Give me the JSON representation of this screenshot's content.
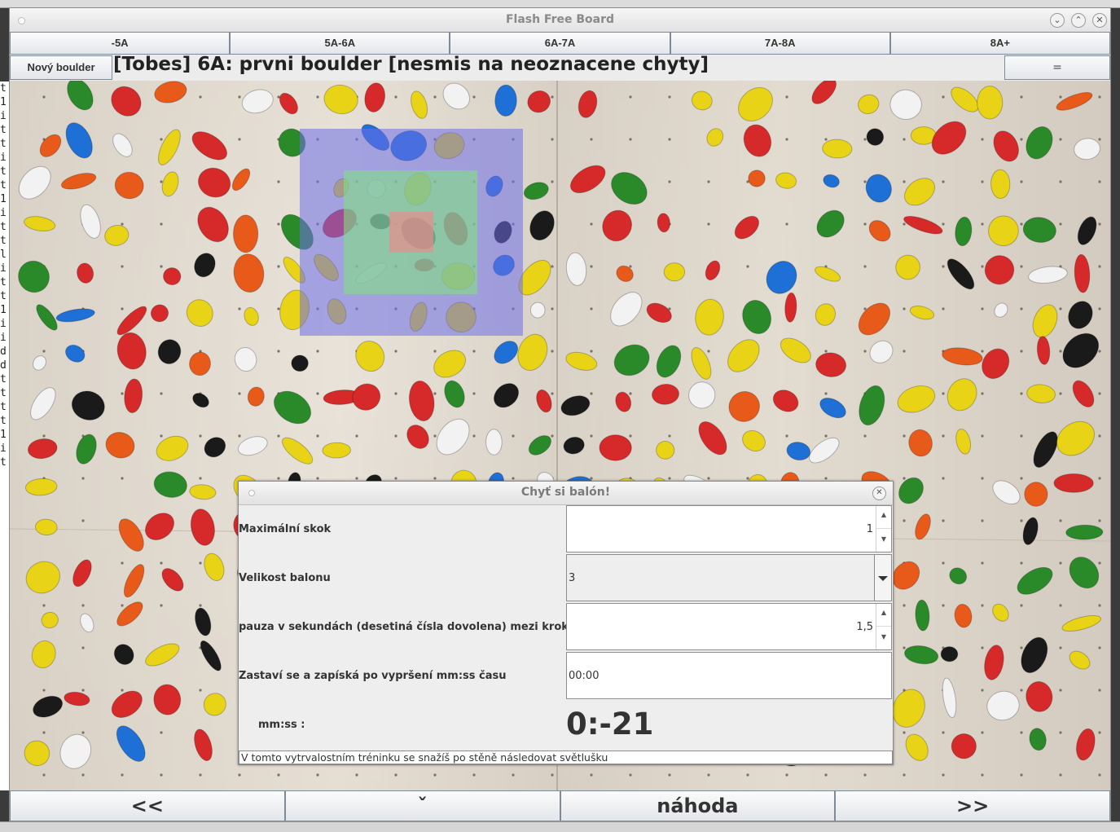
{
  "window": {
    "title": "Flash Free Board"
  },
  "grades": [
    "-5A",
    "5A-6A",
    "6A-7A",
    "7A-8A",
    "8A+"
  ],
  "boulder": {
    "new_label": "Nový boulder",
    "title": "[Tobes] 6A: prvni boulder [nesmis na neoznacene chyty]",
    "menu_label": "="
  },
  "nav": {
    "prev": "<<",
    "middle": "ˇ",
    "random": "náhoda",
    "next": ">>"
  },
  "dialog": {
    "title": "Chyť si balón!",
    "max_jump_label": "Maximální skok",
    "max_jump_value": "1",
    "ball_size_label": "Velikost balonu",
    "ball_size_value": "3",
    "pause_label": "pauza v sekundách (desetiná čísla dovolena) mezi kroky",
    "pause_value": "1,5",
    "stop_label": "Zastaví se a zapíská po  vypršení mm:ss času",
    "stop_value": "00:00",
    "mmss_label": "mm:ss :",
    "timer": "0:-21",
    "description": "V tomto vytrvalostním tréninku se snažíš po stěně následovat světlušku"
  },
  "terminal_chars": "t1ittitt1ittlitt1iiddtttt1it",
  "colors": {
    "focus_outer": "#6d6de8",
    "focus_middle": "#82e082",
    "focus_inner": "#e88c8c"
  }
}
